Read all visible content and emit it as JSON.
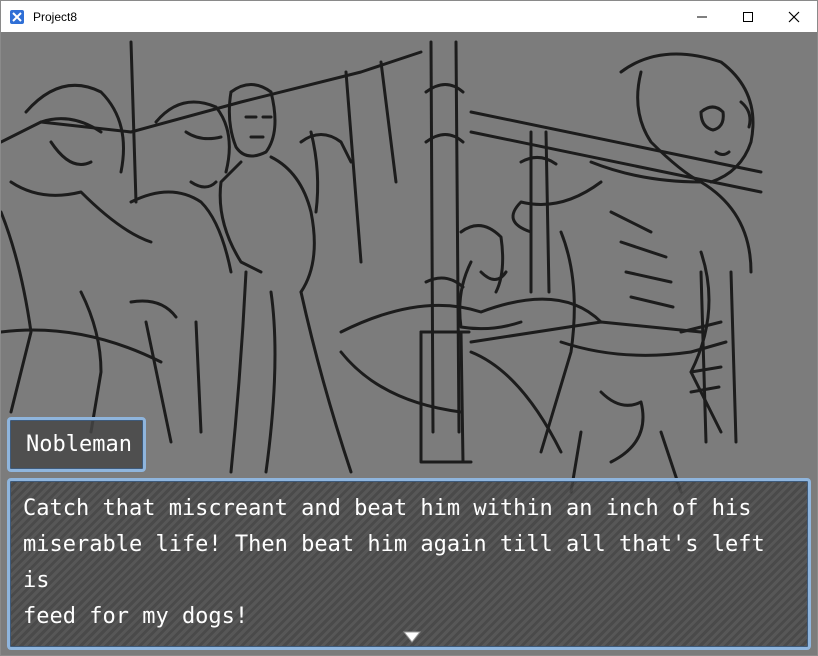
{
  "window": {
    "title": "Project8",
    "icons": {
      "app": "rpgmaker-app-icon",
      "minimize": "minimize-icon",
      "maximize": "maximize-icon",
      "close": "close-icon"
    }
  },
  "dialogue": {
    "speaker": "Nobleman",
    "lines": [
      "Catch that miscreant and beat him within an inch of his",
      "miserable life! Then beat him again till all that's left is",
      "feed for my dogs!"
    ],
    "continue_indicator": "pause-arrow-icon"
  },
  "colors": {
    "window_border": "#8fb5dd",
    "background": "#7c7c7c",
    "text": "#ffffff"
  }
}
